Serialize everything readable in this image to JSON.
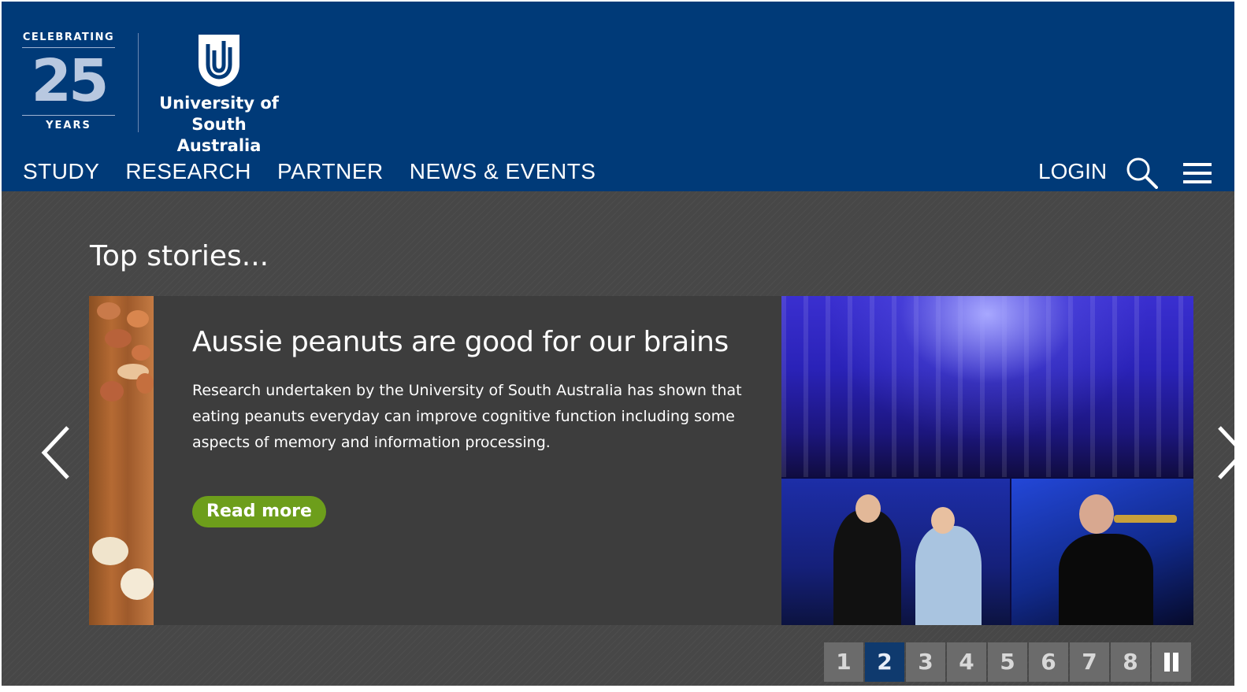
{
  "header": {
    "badge": {
      "celebrating": "CELEBRATING",
      "number": "25",
      "years": "YEARS"
    },
    "logo_text_line1": "University of",
    "logo_text_line2": "South Australia",
    "nav": [
      "STUDY",
      "RESEARCH",
      "PARTNER",
      "NEWS & EVENTS"
    ],
    "login_label": "LOGIN",
    "icons": {
      "search": "search-icon",
      "menu": "hamburger-menu-icon",
      "shield": "unisa-shield-icon"
    }
  },
  "main": {
    "section_title": "Top stories...",
    "slide": {
      "title": "Aussie peanuts are good for our brains",
      "body": "Research undertaken by the University of South Australia has shown that eating peanuts everyday can improve cognitive function including some aspects of memory and information processing.",
      "read_more_label": "Read more"
    },
    "pager": {
      "pages": [
        "1",
        "2",
        "3",
        "4",
        "5",
        "6",
        "7",
        "8"
      ],
      "active_page": "2"
    }
  },
  "colors": {
    "header_bg": "#003a78",
    "content_bg": "#474747",
    "read_more_bg": "#6d9e1b",
    "pager_active_bg": "#0f3a6e",
    "pager_bg": "#6b6b6b"
  }
}
